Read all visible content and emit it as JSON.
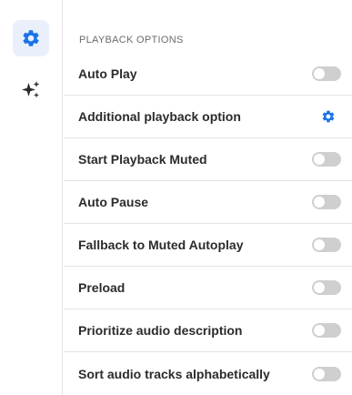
{
  "sidebar": {
    "items": [
      {
        "name": "settings",
        "icon": "gear-icon",
        "active": true
      },
      {
        "name": "sparkle",
        "icon": "sparkle-icon",
        "active": false
      }
    ]
  },
  "panel": {
    "section_title": "PLAYBACK OPTIONS",
    "options": [
      {
        "label": "Auto Play",
        "control": "toggle",
        "on": false
      },
      {
        "label": "Additional playback option",
        "control": "gear-icon"
      },
      {
        "label": "Start Playback Muted",
        "control": "toggle",
        "on": false
      },
      {
        "label": "Auto Pause",
        "control": "toggle",
        "on": false
      },
      {
        "label": "Fallback to Muted Autoplay",
        "control": "toggle",
        "on": false
      },
      {
        "label": "Preload",
        "control": "toggle",
        "on": false
      },
      {
        "label": "Prioritize audio description",
        "control": "toggle",
        "on": false
      },
      {
        "label": "Sort audio tracks alphabetically",
        "control": "toggle",
        "on": false
      }
    ]
  },
  "colors": {
    "accent": "#1a73e8",
    "active_bg": "#e9f0fb",
    "toggle_off": "#cfcfcf",
    "text": "#2b2b2b",
    "muted_text": "#6b6b6b",
    "divider": "#e3e3e3"
  }
}
